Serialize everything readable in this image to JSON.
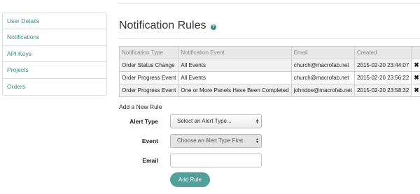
{
  "sidebar": {
    "items": [
      {
        "label": "User Details"
      },
      {
        "label": "Notifications"
      },
      {
        "label": "API Keys"
      },
      {
        "label": "Projects"
      },
      {
        "label": "Orders"
      }
    ]
  },
  "page": {
    "title": "Notification Rules",
    "help_icon": "?"
  },
  "rules_table": {
    "headers": [
      "Notification Type",
      "Notification Event",
      "Email",
      "Created"
    ],
    "rows": [
      {
        "type": "Order Status Change",
        "event": "All Events",
        "email": "church@macrofab.net",
        "created": "2015-02-20 23:44:07",
        "delete": "✖"
      },
      {
        "type": "Order Progress Event",
        "event": "All Events",
        "email": "church@macrofab.net",
        "created": "2015-02-20 23:56:22",
        "delete": "✖"
      },
      {
        "type": "Order Progress Event",
        "event": "One or More Panels Have Been Completed",
        "email": "johndoe@macrofab.net",
        "created": "2015-02-20 23:58:32",
        "delete": "✖"
      }
    ]
  },
  "add_rule": {
    "heading": "Add a New Rule",
    "alert_type_label": "Alert Type",
    "alert_type_value": "Select an Alert Type...",
    "event_label": "Event",
    "event_value": "Choose an Alert Type First",
    "email_label": "Email",
    "email_value": "",
    "submit_label": "Add Rule"
  }
}
